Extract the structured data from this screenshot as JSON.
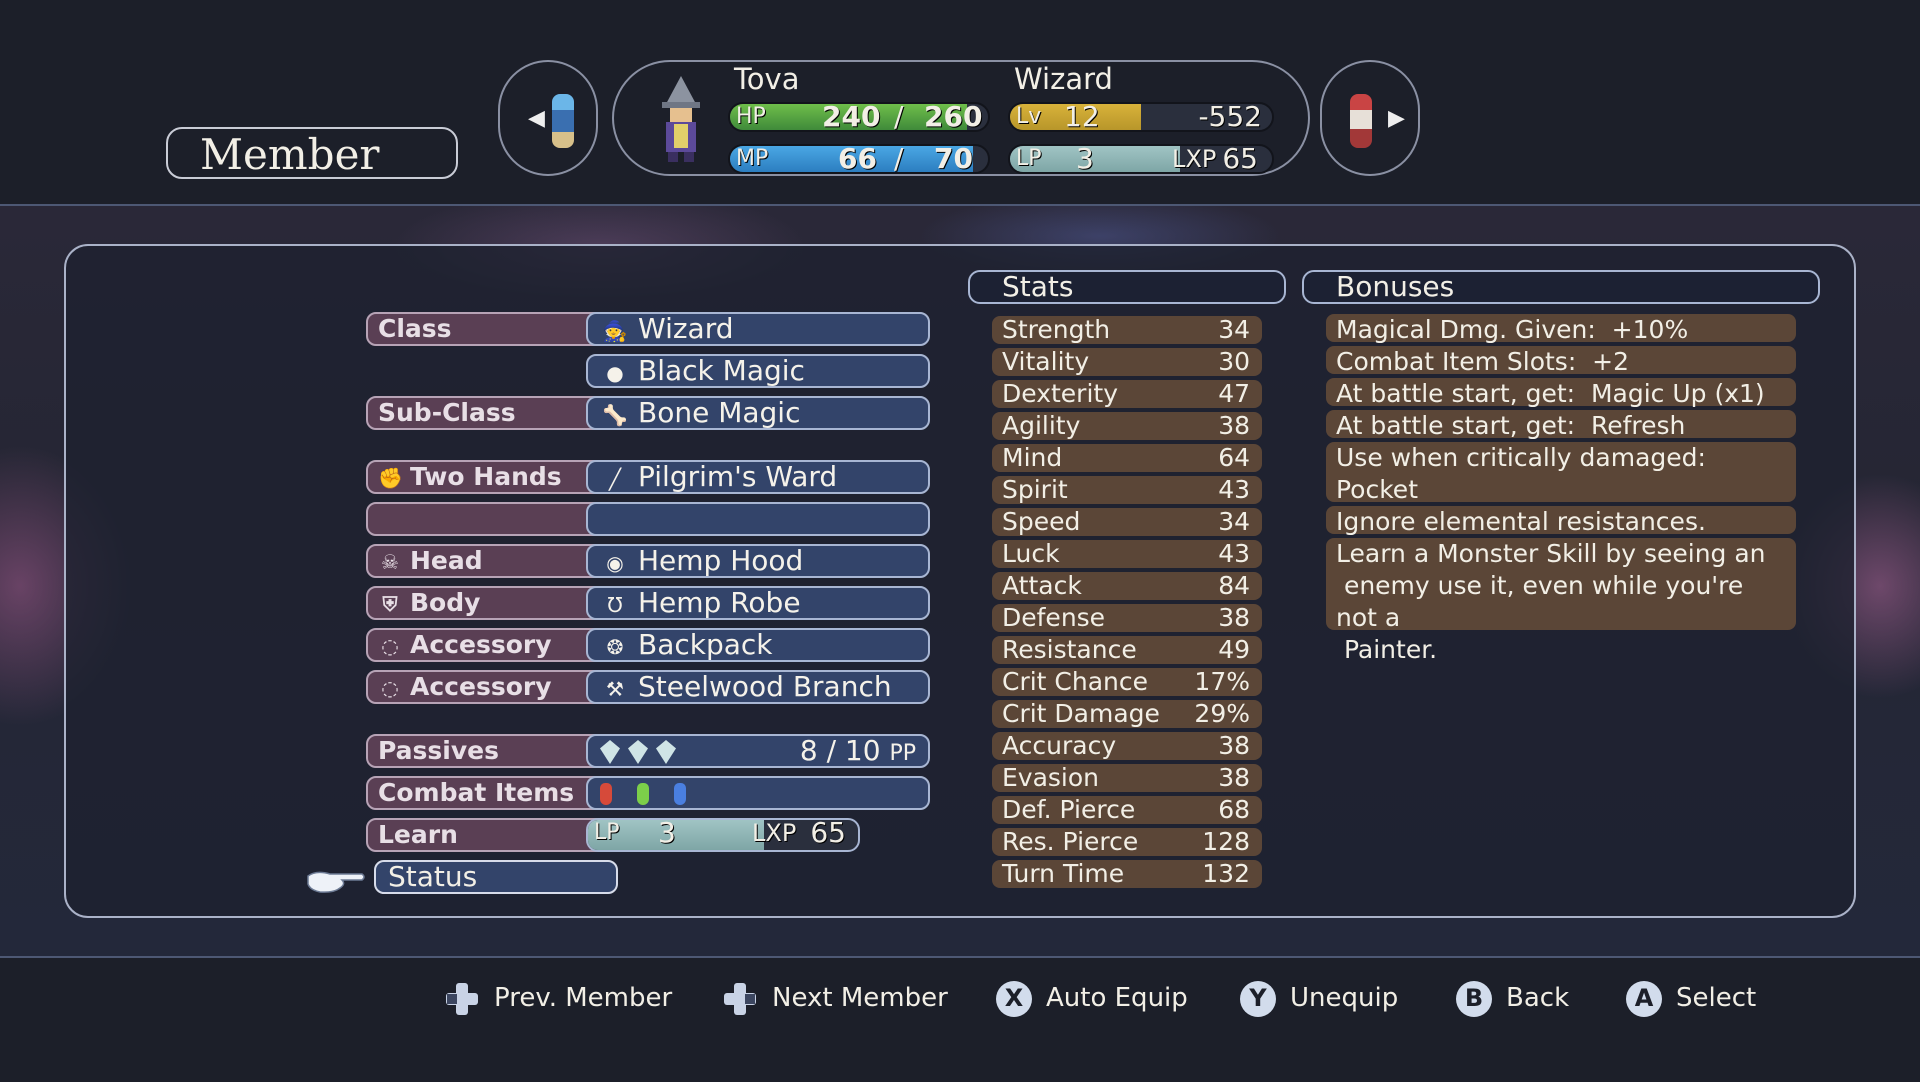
{
  "screen": {
    "title": "Member"
  },
  "party": {
    "character": {
      "name": "Tova",
      "job": "Wizard",
      "hp": {
        "label": "HP",
        "current": "240",
        "sep": "/",
        "max": "260",
        "fill": 0.92
      },
      "mp": {
        "label": "MP",
        "current": "66",
        "sep": "/",
        "max": "70",
        "fill": 0.94
      },
      "lv": {
        "label": "Lv",
        "value": "12",
        "exp": "-552",
        "fill": 0.5
      },
      "lp": {
        "label": "LP",
        "value": "3",
        "lxp_label": "LXP",
        "lxp": "65",
        "fill": 0.65
      }
    },
    "prev_icon": "arrow-left-icon",
    "next_icon": "arrow-right-icon"
  },
  "equipment": {
    "class_label": "Class",
    "class_value": "Wizard",
    "class_skill": "Black Magic",
    "subclass_label": "Sub-Class",
    "subclass_value": "Bone Magic",
    "slots": [
      {
        "label": "Two Hands",
        "value": "Pilgrim's Ward",
        "icon": "fist-icon",
        "item_icon": "staff-icon"
      },
      {
        "label": "",
        "value": "",
        "icon": "",
        "item_icon": ""
      },
      {
        "label": "Head",
        "value": "Hemp Hood",
        "icon": "skull-icon",
        "item_icon": "hood-icon"
      },
      {
        "label": "Body",
        "value": "Hemp Robe",
        "icon": "armor-icon",
        "item_icon": "robe-icon"
      },
      {
        "label": "Accessory",
        "value": "Backpack",
        "icon": "ring-icon",
        "item_icon": "backpack-icon"
      },
      {
        "label": "Accessory",
        "value": "Steelwood Branch",
        "icon": "ring-icon",
        "item_icon": "branch-icon"
      }
    ],
    "passives_label": "Passives",
    "passives_value": "8 / 10",
    "passives_unit": "PP",
    "combat_items_label": "Combat Items",
    "learn_label": "Learn",
    "learn_lp_label": "LP",
    "learn_lp": "3",
    "learn_lxp_label": "LXP",
    "learn_lxp": "65",
    "learn_fill": 0.65,
    "status_label": "Status"
  },
  "stats": {
    "header": "Stats",
    "rows": [
      {
        "name": "Strength",
        "value": "34"
      },
      {
        "name": "Vitality",
        "value": "30"
      },
      {
        "name": "Dexterity",
        "value": "47"
      },
      {
        "name": "Agility",
        "value": "38"
      },
      {
        "name": "Mind",
        "value": "64"
      },
      {
        "name": "Spirit",
        "value": "43"
      },
      {
        "name": "Speed",
        "value": "34"
      },
      {
        "name": "Luck",
        "value": "43"
      },
      {
        "name": "Attack",
        "value": "84"
      },
      {
        "name": "Defense",
        "value": "38"
      },
      {
        "name": "Resistance",
        "value": "49"
      },
      {
        "name": "Crit Chance",
        "value": "17%"
      },
      {
        "name": "Crit Damage",
        "value": "29%"
      },
      {
        "name": "Accuracy",
        "value": "38"
      },
      {
        "name": "Evasion",
        "value": "38"
      },
      {
        "name": "Def. Pierce",
        "value": "68"
      },
      {
        "name": "Res. Pierce",
        "value": "128"
      },
      {
        "name": "Turn Time",
        "value": "132"
      }
    ]
  },
  "bonuses": {
    "header": "Bonuses",
    "rows": [
      "Magical Dmg. Given:  +10%",
      "Combat Item Slots:  +2",
      "At battle start, get:  Magic Up (x1)",
      "At battle start, get:  Refresh",
      "Use when critically damaged:  Pocket\n Sand",
      "Ignore elemental resistances.",
      "Learn a Monster Skill by seeing an\n enemy use it, even while you're not a\n Painter."
    ]
  },
  "footer": {
    "prev_member": "Prev. Member",
    "next_member": "Next Member",
    "auto_equip_btn": "X",
    "auto_equip": "Auto Equip",
    "unequip_btn": "Y",
    "unequip": "Unequip",
    "back_btn": "B",
    "back": "Back",
    "select_btn": "A",
    "select": "Select"
  },
  "colors": {
    "hp_bar": "#3f8a3a",
    "mp_bar": "#2c7ec0",
    "lv_bar": "#b8962a",
    "lp_bar": "#7ea6a6",
    "label_bg": "#5a3f54",
    "value_bg": "#33446a",
    "stat_bg": "#5b4637"
  }
}
